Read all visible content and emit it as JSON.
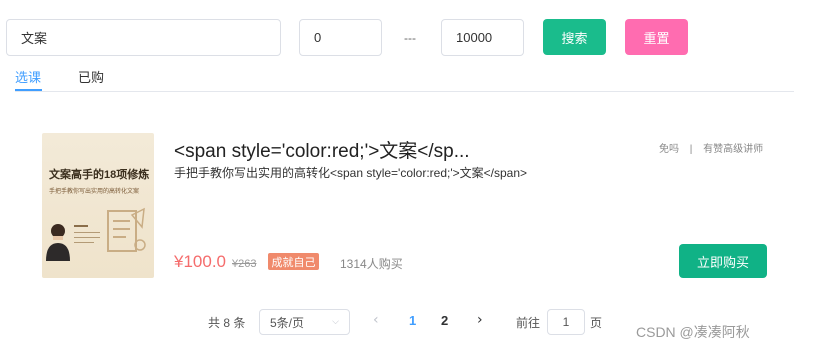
{
  "filters": {
    "keyword_value": "文案",
    "price_min_value": "0",
    "range_separator": "---",
    "price_max_value": "10000",
    "search_label": "搜索",
    "reset_label": "重置"
  },
  "tabs": [
    {
      "label": "选课",
      "active": true
    },
    {
      "label": "已购",
      "active": false
    }
  ],
  "course": {
    "title": "<span style='color:red;'>文案</sp...",
    "description": "手把手教你写出实用的高转化<span style='color:red;'>文案</span>",
    "teacher_name": "免吗",
    "teacher_separator": "|",
    "teacher_title": "有赞高级讲师",
    "thumb_title": "文案高手的18项修炼",
    "thumb_subtitle": "手把手教你写出实用的高转化文案",
    "price": "¥100.0",
    "original_price": "¥263",
    "badge": "成就自己",
    "purchases": "1314人购买",
    "buy_label": "立即购买"
  },
  "pagination": {
    "total": "共 8 条",
    "page_size": "5条/页",
    "pages": [
      "1",
      "2"
    ],
    "current_page": "1",
    "goto_label": "往",
    "goto_prefix": "前往",
    "goto_value": "1",
    "goto_suffix": "页"
  },
  "watermark": "CSDN @凑凑阿秋",
  "colors": {
    "search_bg": "#1abc8c",
    "reset_bg": "#ff6cb0",
    "buy_bg": "#10b286",
    "price": "#f56c6c",
    "active_tab": "#409eff",
    "badge_bg": "#f08a6c"
  }
}
